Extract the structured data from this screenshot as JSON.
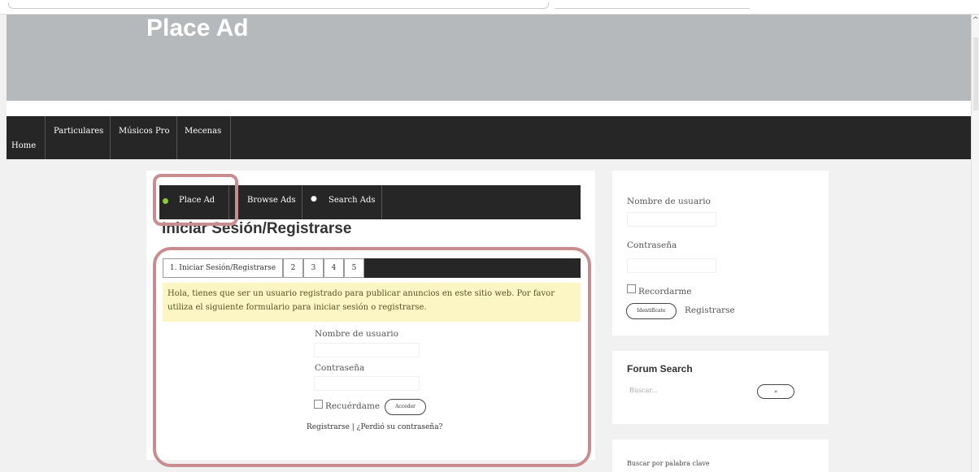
{
  "site": {
    "title": "Place Ad"
  },
  "main_nav": {
    "home": "Home",
    "particulares": "Particulares",
    "musicos_pro": "Músicos Pro",
    "mecenas": "Mecenas"
  },
  "ad_nav": {
    "place": "Place Ad",
    "browse": "Browse Ads",
    "search": "Search Ads"
  },
  "login": {
    "heading": "Iniciar Sesión/Registrarse",
    "steps": [
      "1. Iniciar Sesión/Registrarse",
      "2",
      "3",
      "4",
      "5"
    ],
    "notice": "Hola, tienes que ser un usuario registrado para publicar anuncios en este sitio web. Por favor utiliza el siguiente formulario para iniciar sesión o registrarse.",
    "username_label": "Nombre de usuario",
    "password_label": "Contraseña",
    "remember_label": "Recuérdame",
    "submit_label": "Acceder",
    "links": "Registrarse | ¿Perdió su contraseña?"
  },
  "sidebar": {
    "username_label": "Nombre de usuario",
    "password_label": "Contraseña",
    "remember_label": "Recordarme",
    "identify_label": "Identifícate",
    "register_label": "Registrarse",
    "forum_title": "Forum Search",
    "forum_placeholder": "Buscar...",
    "forum_button": "»",
    "keyword_label": "Buscar por palabra clave"
  },
  "colors": {
    "nav_bg": "#262626",
    "banner_bg": "#b6b9bc",
    "notice_bg": "#fbf6c4",
    "highlight": "#c98d8f",
    "active_dot": "#8ec63f"
  }
}
